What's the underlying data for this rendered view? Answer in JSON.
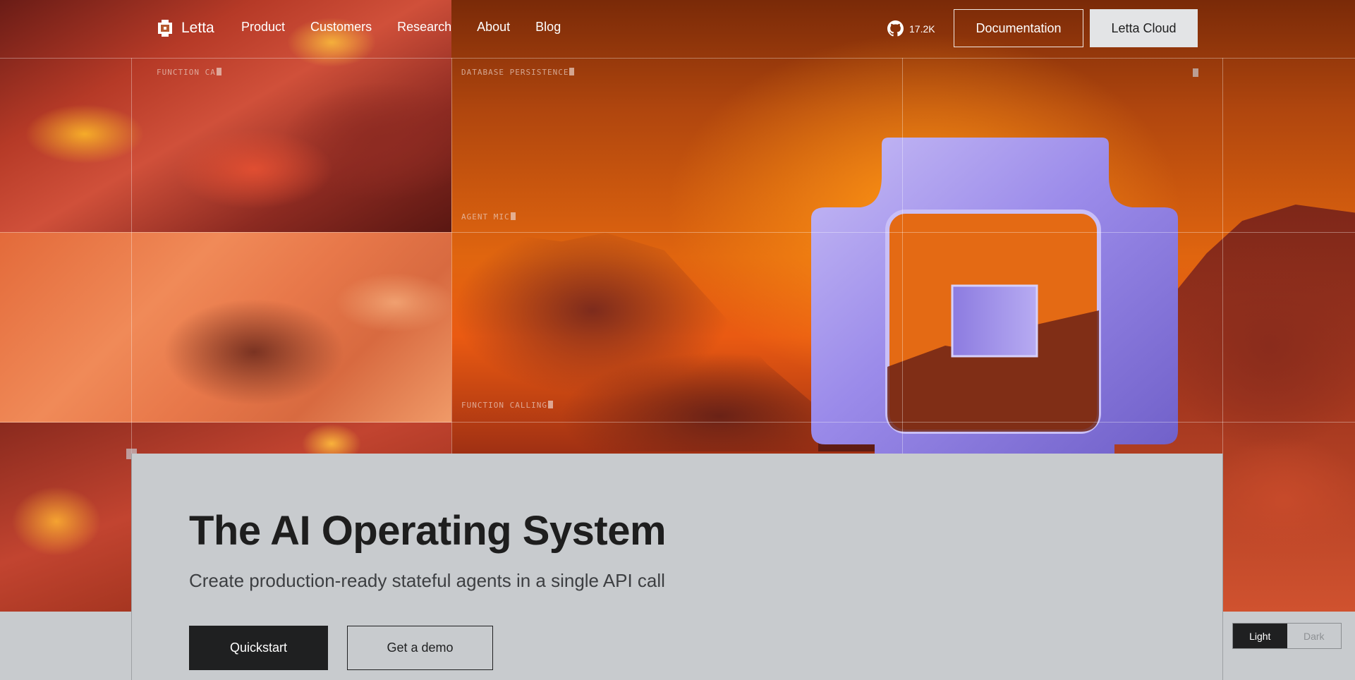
{
  "nav": {
    "brand": "Letta",
    "links": [
      "Product",
      "Customers",
      "Research",
      "About",
      "Blog"
    ],
    "github_stars": "17.2K",
    "docs_label": "Documentation",
    "cloud_label": "Letta Cloud"
  },
  "hero_tags": {
    "function_ca": "Function Ca",
    "database_persistence": "Database Persistence",
    "agent_mic": "Agent Mic",
    "function_calling": "Function Calling"
  },
  "hero": {
    "headline": "The AI Operating System",
    "subheadline": "Create production-ready stateful agents in a single API call",
    "primary_cta": "Quickstart",
    "secondary_cta": "Get a demo"
  },
  "theme": {
    "light": "Light",
    "dark": "Dark",
    "selected": "Light"
  },
  "colors": {
    "accent_dark": "#1f2021",
    "card_bg": "#c8cbce",
    "logo_purple": "#9b8bea",
    "sky_orange": "#e0650f"
  }
}
